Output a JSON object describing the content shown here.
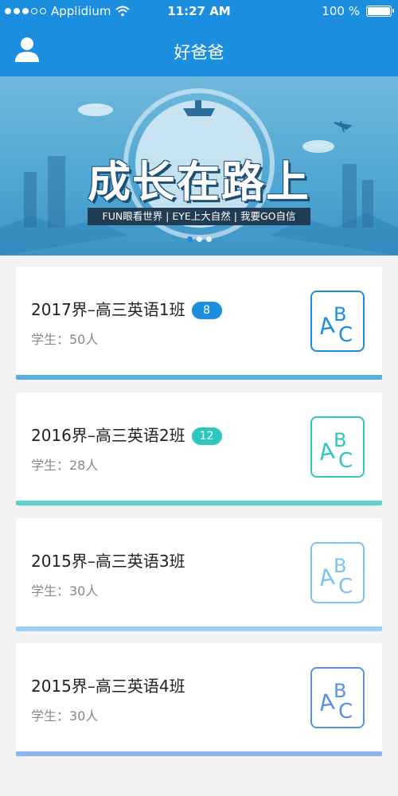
{
  "status_bar": {
    "carrier": "Applidium",
    "time": "11:27 AM",
    "battery": "100 %",
    "battery_level": 1.0
  },
  "nav": {
    "title": "好爸爸",
    "avatar_icon": "user-icon"
  },
  "banner": {
    "title": "成长在路上",
    "subtitle": "FUN眼看世界 | EYE上大自然 | 我要GO自信",
    "page_count": 3,
    "active_page": 1
  },
  "classes": [
    {
      "title": "2017界–高三英语1班",
      "badge": "8",
      "students": "学生：50人",
      "color": "#1b8ee0",
      "stripe": "#5aaee8",
      "icon": "abc-icon"
    },
    {
      "title": "2016界–高三英语2班",
      "badge": "12",
      "students": "学生：28人",
      "color": "#2ec7c0",
      "stripe": "#5ad2cb",
      "icon": "abc-icon"
    },
    {
      "title": "2015界–高三英语3班",
      "badge": "",
      "students": "学生：30人",
      "color": "#7cc2f2",
      "stripe": "#9ccff3",
      "icon": "abc-icon"
    },
    {
      "title": "2015界–高三英语4班",
      "badge": "",
      "students": "学生：30人",
      "color": "#5a8fe4",
      "stripe": "#8cb3ee",
      "icon": "abc-icon"
    }
  ]
}
